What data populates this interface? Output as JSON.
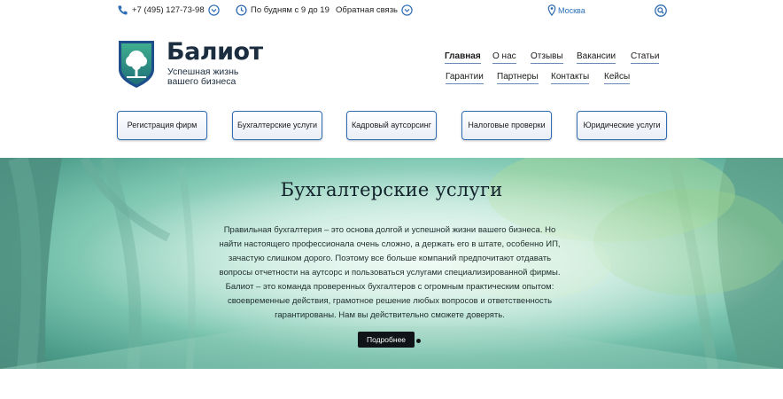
{
  "topbar": {
    "phone": "+7 (495) 127-73-98",
    "hours": "По будням с 9 до 19",
    "callback": "Обратная связь",
    "city": "Москва"
  },
  "brand": {
    "name": "Балиот",
    "tagline": "Успешная жизнь вашего бизнеса"
  },
  "nav": {
    "row1": [
      "Главная",
      "О нас",
      "Отзывы",
      "Вакансии",
      "Статьи"
    ],
    "row2": [
      "Гарантии",
      "Партнеры",
      "Контакты",
      "Кейсы"
    ]
  },
  "services": [
    "Регистрация фирм",
    "Бухгалтерские услуги",
    "Кадровый аутсорсинг",
    "Налоговые проверки",
    "Юридические услуги"
  ],
  "hero": {
    "title": "Бухгалтерские услуги",
    "text": "Правильная бухгалтерия – это основа долгой и успешной жизни вашего бизнеса. Но найти настоящего профессионала очень сложно, а держать его в штате, особенно ИП, зачастую слишком дорого. Поэтому все больше компаний предпочитают отдавать вопросы отчетности на аутсорс и пользоваться услугами специализированной фирмы. Балиот – это команда проверенных бухгалтеров с огромным практическим опытом: своевременные действия, грамотное решение любых вопросов и ответственность гарантированы. Нам вы действительно сможете доверять.",
    "button": "Подробнее"
  },
  "colors": {
    "accent": "#2e6cb4",
    "brand_text": "#1b2d3f",
    "logo_green": "#2f8f7a"
  },
  "icons": [
    "phone-icon",
    "clock-icon",
    "chevron-down-icon",
    "location-pin-icon",
    "search-icon",
    "tree-shield-logo"
  ]
}
